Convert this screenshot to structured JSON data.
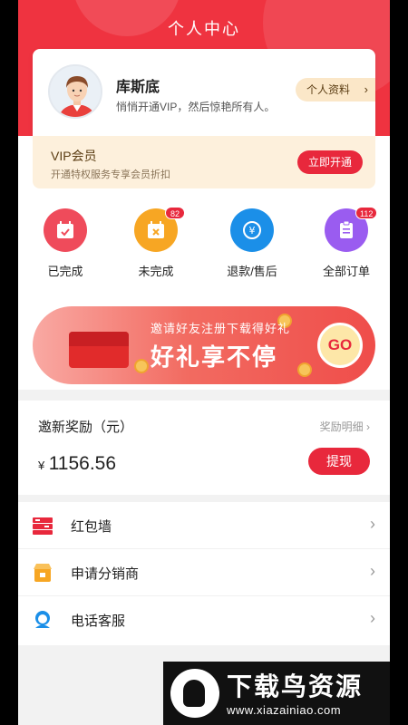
{
  "header": {
    "title": "个人中心"
  },
  "profile": {
    "name": "库斯底",
    "subtitle": "悄悄开通VIP，然后惊艳所有人。",
    "profile_button": "个人资料"
  },
  "vip": {
    "title": "VIP会员",
    "subtitle": "开通特权服务专享会员折扣",
    "button": "立即开通"
  },
  "orders": [
    {
      "label": "已完成",
      "badge": "",
      "icon": "calendar-check-icon",
      "color": "#ef4b5b"
    },
    {
      "label": "未完成",
      "badge": "82",
      "icon": "calendar-cancel-icon",
      "color": "#f7a623"
    },
    {
      "label": "退款/售后",
      "badge": "",
      "icon": "yen-refresh-icon",
      "color": "#1b8fe8"
    },
    {
      "label": "全部订单",
      "badge": "112",
      "icon": "clipboard-icon",
      "color": "#9a5cf0"
    }
  ],
  "banner": {
    "small_text": "邀请好友注册下载得好礼",
    "big_text": "好礼享不停",
    "go": "GO"
  },
  "reward": {
    "title": "邀新奖励（元）",
    "detail": "奖励明细",
    "currency": "¥",
    "amount": "1156.56",
    "button": "提现"
  },
  "menu": [
    {
      "label": "红包墙",
      "icon": "red-envelope-icon"
    },
    {
      "label": "申请分销商",
      "icon": "shop-icon"
    },
    {
      "label": "电话客服",
      "icon": "headset-icon"
    }
  ],
  "watermark": {
    "text": "下载鸟资源",
    "url": "www.xiazainiao.com"
  },
  "colors": {
    "primary": "#e8283c",
    "vip_bg": "#fdf0dc"
  }
}
